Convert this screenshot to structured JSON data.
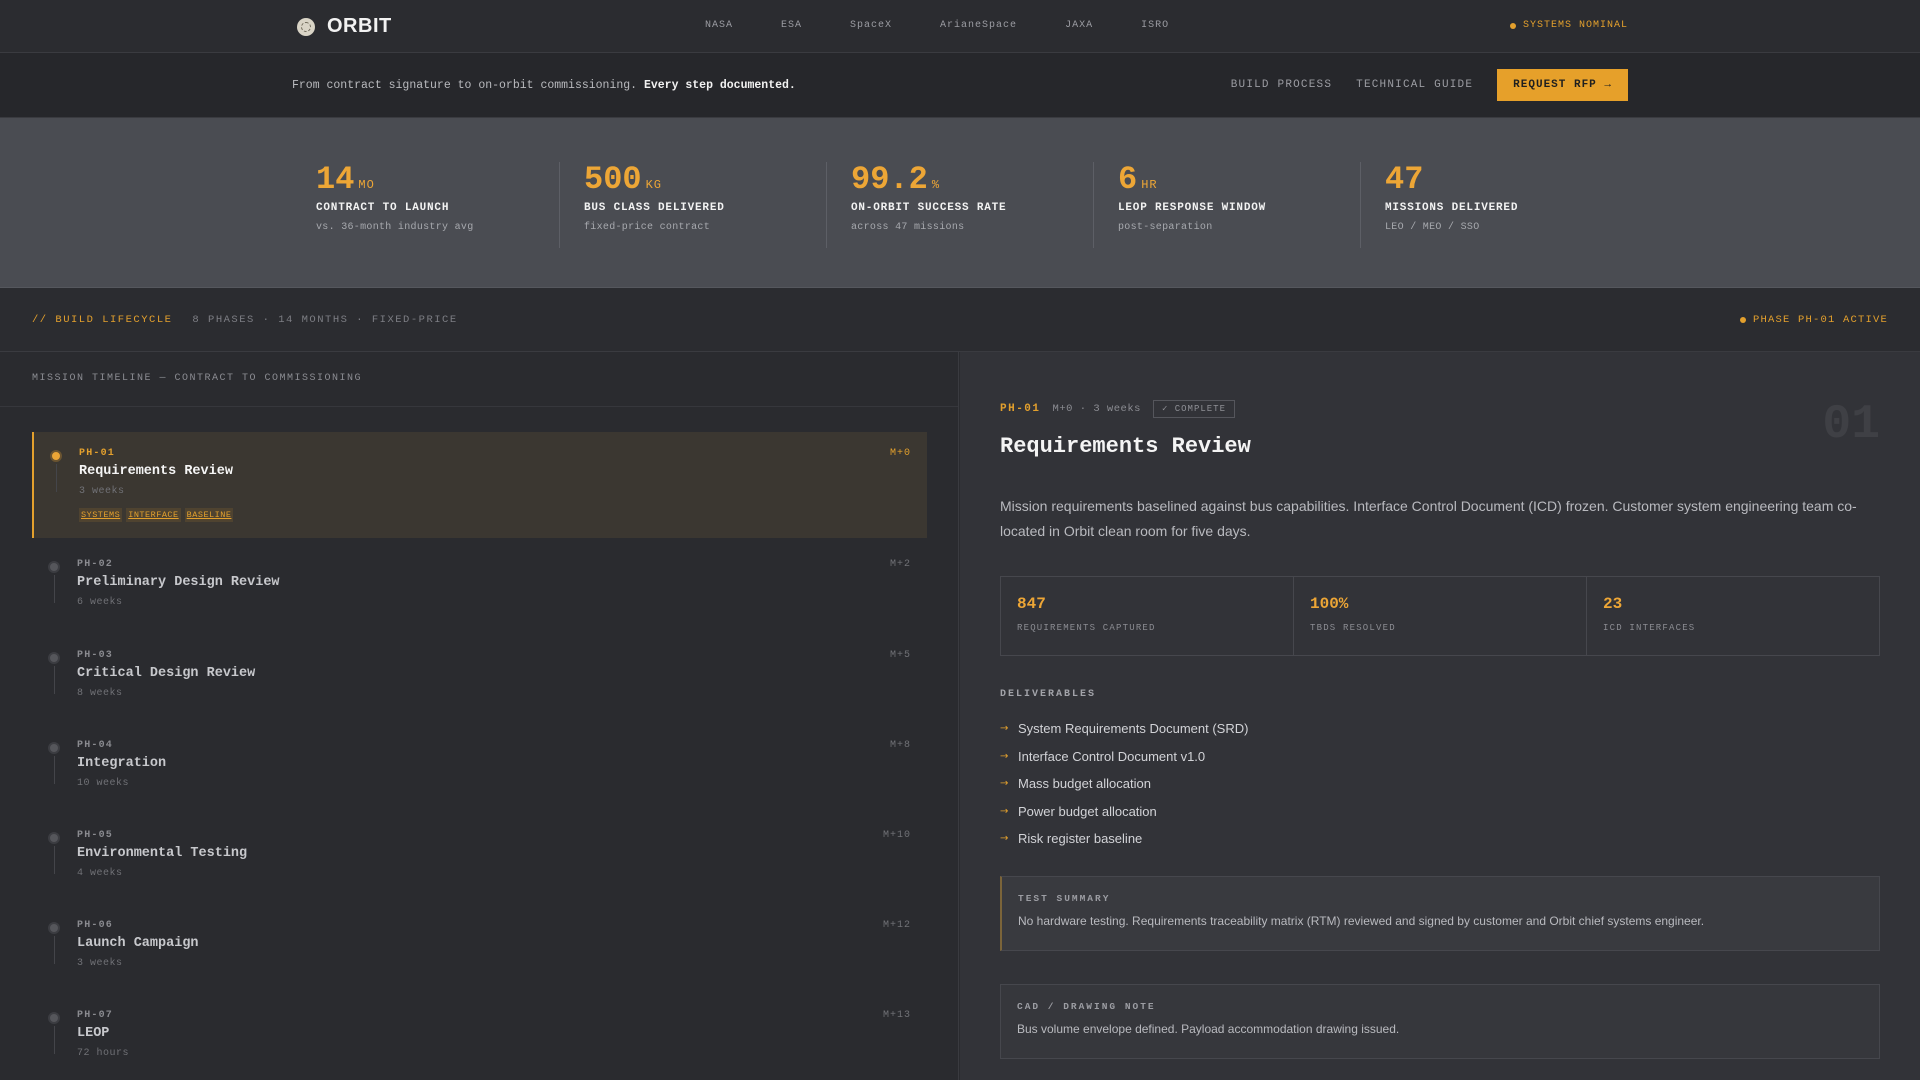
{
  "brand": {
    "name": "ORBIT"
  },
  "nav": {
    "partners": [
      "NASA",
      "ESA",
      "SpaceX",
      "ArianeSpace",
      "JAXA",
      "ISRO"
    ],
    "status": "SYSTEMS NOMINAL"
  },
  "subbar": {
    "tagline": "From contract signature to on-orbit commissioning.",
    "tagline_emph": "Every step documented.",
    "links": [
      "BUILD PROCESS",
      "TECHNICAL GUIDE"
    ],
    "cta": "REQUEST RFP →"
  },
  "stats": [
    {
      "value": "14",
      "unit": "MO",
      "label": "CONTRACT TO LAUNCH",
      "sub": "vs. 36-month industry avg"
    },
    {
      "value": "500",
      "unit": "KG",
      "label": "BUS CLASS DELIVERED",
      "sub": "fixed-price contract"
    },
    {
      "value": "99.2",
      "unit": "%",
      "label": "ON-ORBIT SUCCESS RATE",
      "sub": "across 47 missions"
    },
    {
      "value": "6",
      "unit": "HR",
      "label": "LEOP RESPONSE WINDOW",
      "sub": "post-separation"
    },
    {
      "value": "47",
      "unit": "",
      "label": "MISSIONS DELIVERED",
      "sub": "LEO / MEO / SSO"
    }
  ],
  "lifecycle": {
    "title": "// BUILD LIFECYCLE",
    "meta": "8 PHASES · 14 MONTHS · FIXED-PRICE",
    "status": "PHASE PH-01 ACTIVE"
  },
  "timeline": {
    "heading": "MISSION TIMELINE — CONTRACT TO COMMISSIONING",
    "phases": [
      {
        "id": "PH-01",
        "name": "Requirements Review",
        "duration": "3 weeks",
        "month": "M+0",
        "tags": [
          "SYSTEMS",
          "INTERFACE",
          "BASELINE"
        ]
      },
      {
        "id": "PH-02",
        "name": "Preliminary Design Review",
        "duration": "6 weeks",
        "month": "M+2"
      },
      {
        "id": "PH-03",
        "name": "Critical Design Review",
        "duration": "8 weeks",
        "month": "M+5"
      },
      {
        "id": "PH-04",
        "name": "Integration",
        "duration": "10 weeks",
        "month": "M+8"
      },
      {
        "id": "PH-05",
        "name": "Environmental Testing",
        "duration": "4 weeks",
        "month": "M+10"
      },
      {
        "id": "PH-06",
        "name": "Launch Campaign",
        "duration": "3 weeks",
        "month": "M+12"
      },
      {
        "id": "PH-07",
        "name": "LEOP",
        "duration": "72 hours",
        "month": "M+13"
      }
    ]
  },
  "detail": {
    "number": "01",
    "id": "PH-01",
    "meta": "M+0 · 3 weeks",
    "badge": "✓ COMPLETE",
    "title": "Requirements Review",
    "description": "Mission requirements baselined against bus capabilities. Interface Control Document (ICD) frozen. Customer system engineering team co-located in Orbit clean room for five days.",
    "metrics": [
      {
        "value": "847",
        "label": "REQUIREMENTS CAPTURED"
      },
      {
        "value": "100%",
        "label": "TBDS RESOLVED"
      },
      {
        "value": "23",
        "label": "ICD INTERFACES"
      }
    ],
    "deliverables_heading": "DELIVERABLES",
    "deliverables": [
      "System Requirements Document (SRD)",
      "Interface Control Document v1.0",
      "Mass budget allocation",
      "Power budget allocation",
      "Risk register baseline"
    ],
    "test_summary": {
      "heading": "TEST SUMMARY",
      "text": "No hardware testing. Requirements traceability matrix (RTM) reviewed and signed by customer and Orbit chief systems engineer."
    },
    "cad_note": {
      "heading": "CAD / DRAWING NOTE",
      "text": "Bus volume envelope defined. Payload accommodation drawing issued."
    }
  },
  "colors": {
    "accent": "#e3a02d",
    "background": "#2a2b2f",
    "stats_band": "#4a4c52"
  }
}
